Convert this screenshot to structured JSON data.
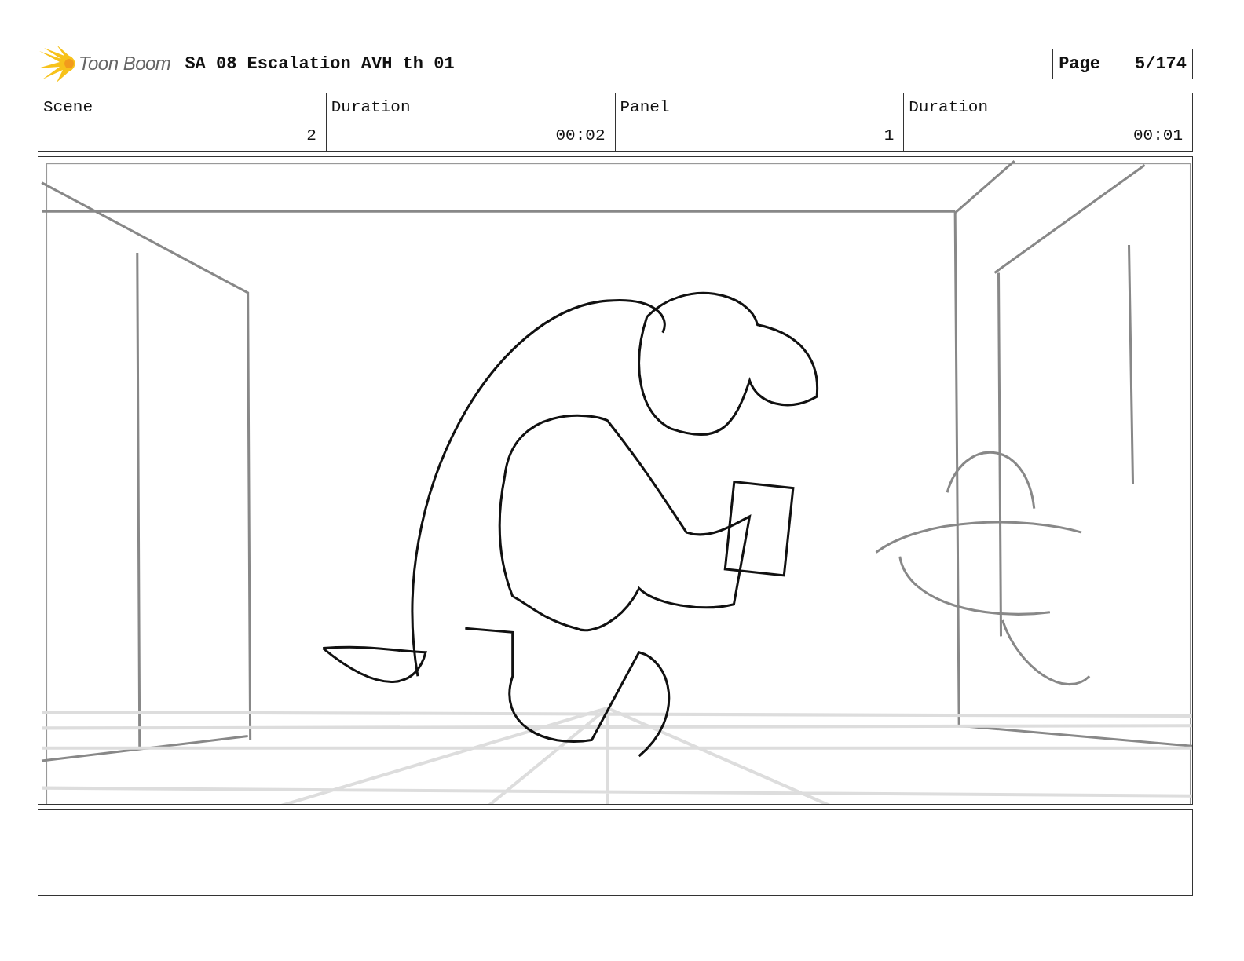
{
  "header": {
    "logo_text": "Toon Boom",
    "title": "SA 08 Escalation AVH th 01",
    "page_label": "Page",
    "page_value": "5/174"
  },
  "fields": [
    {
      "label": "Scene",
      "value": "2"
    },
    {
      "label": "Duration",
      "value": "00:02"
    },
    {
      "label": "Panel",
      "value": "1"
    },
    {
      "label": "Duration",
      "value": "00:01"
    }
  ]
}
